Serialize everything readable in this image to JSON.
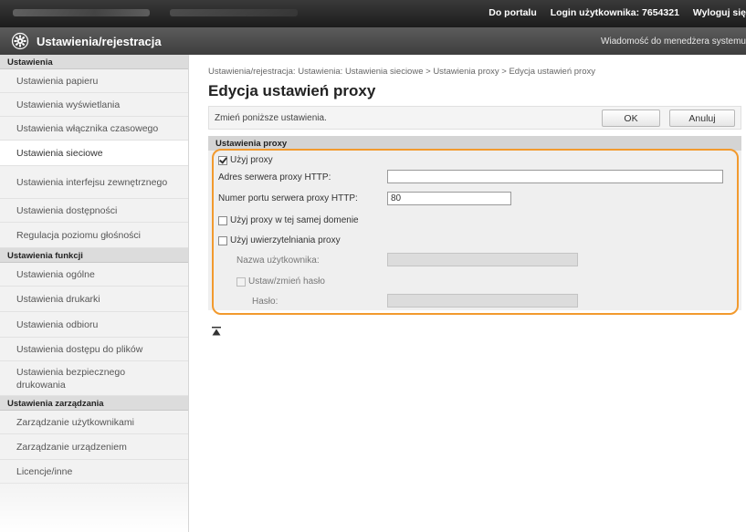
{
  "topbar": {
    "portal_link": "Do portalu",
    "login_label": "Login użytkownika:",
    "login_value": "7654321",
    "logout_link": "Wyloguj się"
  },
  "titlebar": {
    "icon": "gear-icon",
    "title": "Ustawienia/rejestracja",
    "message_link": "Wiadomość do menedżera systemu"
  },
  "sidebar": {
    "sections": [
      {
        "heading": "Ustawienia",
        "items": [
          {
            "label": "Ustawienia papieru"
          },
          {
            "label": "Ustawienia wyświetlania"
          },
          {
            "label": "Ustawienia włącznika czasowego"
          },
          {
            "label": "Ustawienia sieciowe",
            "active": true
          },
          {
            "label": "Ustawienia interfejsu zewnętrznego"
          },
          {
            "label": "Ustawienia dostępności"
          },
          {
            "label": "Regulacja poziomu głośności"
          }
        ]
      },
      {
        "heading": "Ustawienia funkcji",
        "items": [
          {
            "label": "Ustawienia ogólne"
          },
          {
            "label": "Ustawienia drukarki"
          },
          {
            "label": "Ustawienia odbioru"
          },
          {
            "label": "Ustawienia dostępu do plików"
          },
          {
            "label": "Ustawienia bezpiecznego drukowania"
          }
        ]
      },
      {
        "heading": "Ustawienia zarządzania",
        "items": [
          {
            "label": "Zarządzanie użytkownikami"
          },
          {
            "label": "Zarządzanie urządzeniem"
          },
          {
            "label": "Licencje/inne"
          }
        ]
      }
    ]
  },
  "main": {
    "breadcrumb": "Ustawienia/rejestracja: Ustawienia: Ustawienia sieciowe > Ustawienia proxy > Edycja ustawień proxy",
    "page_title": "Edycja ustawień proxy",
    "instruction": "Zmień poniższe ustawienia.",
    "ok_label": "OK",
    "cancel_label": "Anuluj",
    "section_title": "Ustawienia proxy",
    "use_proxy_label": "Użyj proxy",
    "use_proxy_checked": true,
    "http_server_label": "Adres serwera proxy HTTP:",
    "http_server_value": "",
    "http_port_label": "Numer portu serwera proxy HTTP:",
    "http_port_value": "80",
    "same_domain_label": "Użyj proxy w tej samej domenie",
    "same_domain_checked": false,
    "auth_label": "Użyj uwierzytelniania proxy",
    "auth_checked": false,
    "username_label": "Nazwa użytkownika:",
    "username_value": "",
    "set_password_label": "Ustaw/zmień hasło",
    "password_label": "Hasło:",
    "password_value": ""
  },
  "colors": {
    "highlight_border": "#f29a2e",
    "topbar_bg": "#1c1c1c",
    "titlebar_bg": "#3e3e3e",
    "section_head_bg": "#d4d4d4"
  }
}
